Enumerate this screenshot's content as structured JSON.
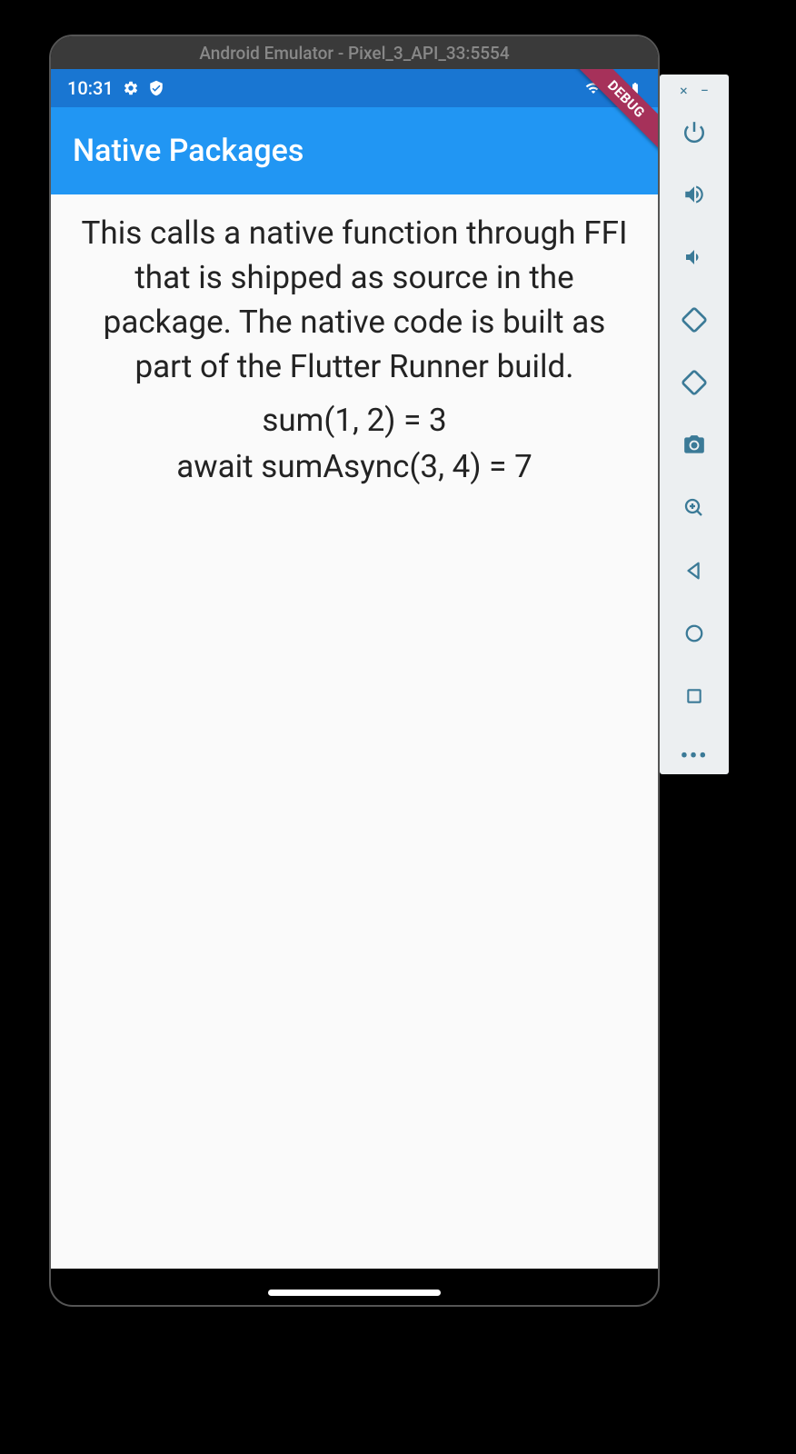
{
  "emulator": {
    "title": "Android Emulator - Pixel_3_API_33:5554"
  },
  "statusBar": {
    "time": "10:31"
  },
  "appBar": {
    "title": "Native Packages",
    "debugLabel": "DEBUG"
  },
  "content": {
    "description": "This calls a native function through FFI that is shipped as source in the package. The native code is built as part of the Flutter Runner build.",
    "line1": "sum(1, 2) = 3",
    "line2": "await sumAsync(3, 4) = 7"
  },
  "toolbar": {
    "close": "×",
    "minimize": "−",
    "more": "•••"
  }
}
